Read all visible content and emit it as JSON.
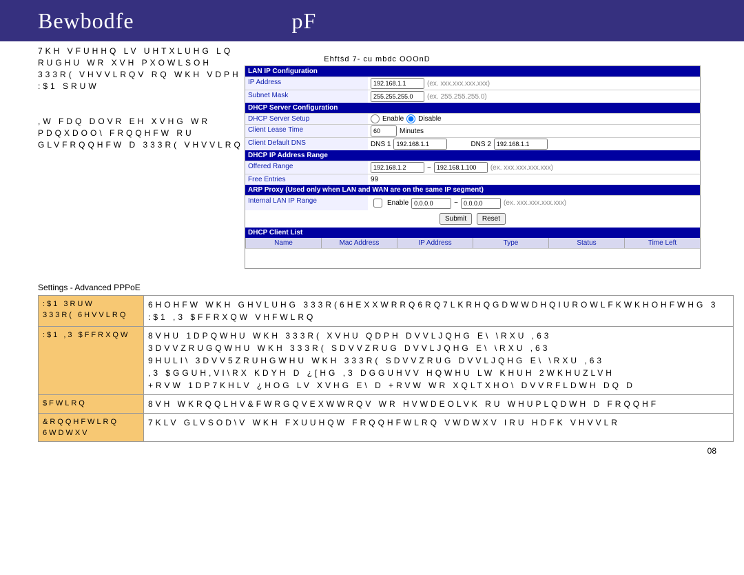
{
  "header": {
    "left": "Bewbodfe",
    "right": "pF"
  },
  "figure_caption": "Ehftṡd 7- cu mbdc OOOnD",
  "left_para_lines": [
    "7KH VFUHHQ LV UHTXLUHG LQ RUGHU WR XVH PXOWLSOH",
    "333R( VHVVLRQV RQ WKH VDPH :$1 SRUW",
    "",
    ",W FDQ DOVR EH XVHG WR PDQXDOO\\ FRQQHFW RU",
    "GLVFRQQHFW D 333R( VHVVLRQ"
  ],
  "cfg": {
    "sec1": "LAN IP Configuration",
    "ip_label": "IP Address",
    "ip_val": "192.168.1.1",
    "ip_ex": "(ex. xxx.xxx.xxx.xxx)",
    "mask_label": "Subnet Mask",
    "mask_val": "255.255.255.0",
    "mask_ex": "(ex. 255.255.255.0)",
    "sec2": "DHCP Server Configuration",
    "setup_label": "DHCP Server Setup",
    "enable": "Enable",
    "disable": "Disable",
    "lease_label": "Client Lease Time",
    "lease_val": "60",
    "minutes": "Minutes",
    "dns_label": "Client Default DNS",
    "dns1": "DNS 1",
    "dns2": "DNS 2",
    "dns_val": "192.168.1.1",
    "sec3": "DHCP IP Address Range",
    "offered_label": "Offered Range",
    "off1": "192.168.1.2",
    "off2": "192.168.1.100",
    "off_ex": "(ex. xxx.xxx.xxx.xxx)",
    "free_label": "Free Entries",
    "free_val": "99",
    "sec4": "ARP Proxy (Used only when LAN and WAN are on the same IP segment)",
    "arp_label": "Internal LAN IP Range",
    "arp_enable": "Enable",
    "arp1": "0.0.0.0",
    "arp2": "0.0.0.0",
    "arp_ex": "(ex. xxx.xxx.xxx.xxx)",
    "submit": "Submit",
    "reset": "Reset",
    "sec5": "DHCP Client List",
    "cols": [
      "Name",
      "Mac Address",
      "IP Address",
      "Type",
      "Status",
      "Time Left"
    ]
  },
  "settings_title": "Settings - Advanced PPPoE",
  "rows": [
    {
      "lbl": ":$1 3RUW\n333R( 6HVVLRQ",
      "desc": "6HOHFW WKH GHVLUHG 333R(6HEXXWRRQ6RQ7LKRHQGDWWDHQIUROWLFKWKHOHFWHG 3\n:$1 ,3 $FFRXQW VHFWLRQ"
    },
    {
      "lbl": ":$1 ,3 $FFRXQW",
      "desc": "8VHU 1DPQWHU WKH 333R( XVHU QDPH DVVLJQHG E\\ \\RXU ,63\n3DVVZRUGQWHU WKH 333R( SDVVZRUG DVVLJQHG E\\ \\RXU ,63\n9HULI\\ 3DVV5ZRUHGWHU WKH 333R( SDVVZRUG DVVLJQHG E\\ \\RXU ,63\n,3 $GGUH,VI\\RX KDYH D ¿[HG ,3 DGGUHVV HQWHU LW KHUH 2WKHUZLVH\n+RVW 1DP7KHLV ¿HOG LV XVHG E\\ D +RVW WR XQLTXHO\\ DVVRFLDWH DQ D"
    },
    {
      "lbl": "$FWLRQ",
      "desc": "8VH WKRQQLHV&FWRGQVEXWWRQV WR HVWDEOLVK RU WHUPLQDWH D FRQQHF"
    },
    {
      "lbl": "&RQQHFWLRQ 6WDWXV",
      "desc": "7KLV GLVSOD\\V WKH FXUUHQW FRQQHFWLRQ VWDWXV IRU HDFK VHVVLR"
    }
  ],
  "pagenum": "08"
}
